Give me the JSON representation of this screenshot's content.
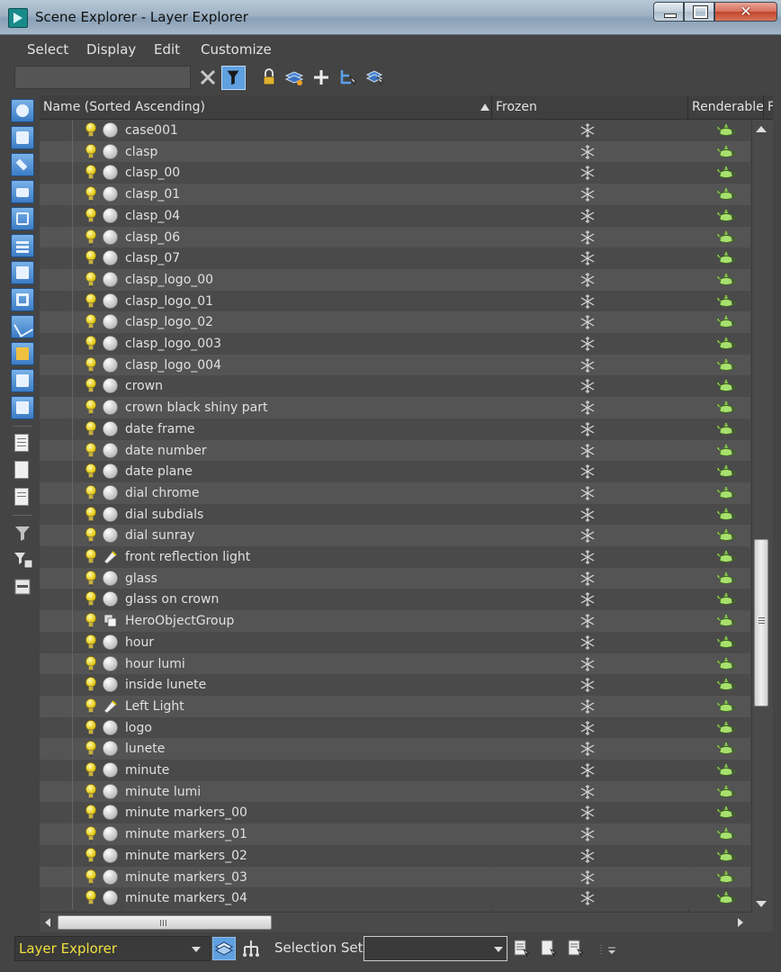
{
  "window": {
    "title": "Scene Explorer - Layer Explorer",
    "close_glyph": "✕"
  },
  "menu": {
    "items": [
      "Select",
      "Display",
      "Edit",
      "Customize"
    ]
  },
  "toolbar": {
    "search_value": "",
    "icons": [
      "clear-icon",
      "filter-icon",
      "lock-icon",
      "layer-add-icon",
      "plus-icon",
      "hierarchy-select-icon",
      "layer-select-icon"
    ]
  },
  "columns": {
    "name": "Name (Sorted Ascending)",
    "frozen": "Frozen",
    "renderable": "Renderable",
    "next": "F"
  },
  "rows": [
    {
      "name": "case001",
      "type": "geometry"
    },
    {
      "name": "clasp",
      "type": "geometry"
    },
    {
      "name": "clasp_00",
      "type": "geometry"
    },
    {
      "name": "clasp_01",
      "type": "geometry"
    },
    {
      "name": "clasp_04",
      "type": "geometry"
    },
    {
      "name": "clasp_06",
      "type": "geometry"
    },
    {
      "name": "clasp_07",
      "type": "geometry"
    },
    {
      "name": "clasp_logo_00",
      "type": "geometry"
    },
    {
      "name": "clasp_logo_01",
      "type": "geometry"
    },
    {
      "name": "clasp_logo_02",
      "type": "geometry"
    },
    {
      "name": "clasp_logo_003",
      "type": "geometry"
    },
    {
      "name": "clasp_logo_004",
      "type": "geometry"
    },
    {
      "name": "crown",
      "type": "geometry"
    },
    {
      "name": "crown black shiny part",
      "type": "geometry"
    },
    {
      "name": "date frame",
      "type": "geometry"
    },
    {
      "name": "date number",
      "type": "geometry"
    },
    {
      "name": "date plane",
      "type": "geometry"
    },
    {
      "name": "dial chrome",
      "type": "geometry"
    },
    {
      "name": "dial subdials",
      "type": "geometry"
    },
    {
      "name": "dial sunray",
      "type": "geometry"
    },
    {
      "name": "front reflection light",
      "type": "light"
    },
    {
      "name": "glass",
      "type": "geometry"
    },
    {
      "name": "glass on crown",
      "type": "geometry"
    },
    {
      "name": "HeroObjectGroup",
      "type": "group"
    },
    {
      "name": "hour",
      "type": "geometry"
    },
    {
      "name": "hour lumi",
      "type": "geometry"
    },
    {
      "name": "inside lunete",
      "type": "geometry"
    },
    {
      "name": "Left Light",
      "type": "light"
    },
    {
      "name": "logo",
      "type": "geometry"
    },
    {
      "name": "lunete",
      "type": "geometry"
    },
    {
      "name": "minute",
      "type": "geometry"
    },
    {
      "name": "minute lumi",
      "type": "geometry"
    },
    {
      "name": "minute markers_00",
      "type": "geometry"
    },
    {
      "name": "minute markers_01",
      "type": "geometry"
    },
    {
      "name": "minute markers_02",
      "type": "geometry"
    },
    {
      "name": "minute markers_03",
      "type": "geometry"
    },
    {
      "name": "minute markers_04",
      "type": "geometry"
    }
  ],
  "bottom": {
    "explorer_mode": "Layer Explorer",
    "selection_set_label": "Selection Set:",
    "selection_set_value": ""
  },
  "colors": {
    "explorer_mode_text": "#f0e040",
    "panel_bg": "#444444",
    "row_alt": "#545454",
    "accent_blue": "#3c7cc6"
  }
}
